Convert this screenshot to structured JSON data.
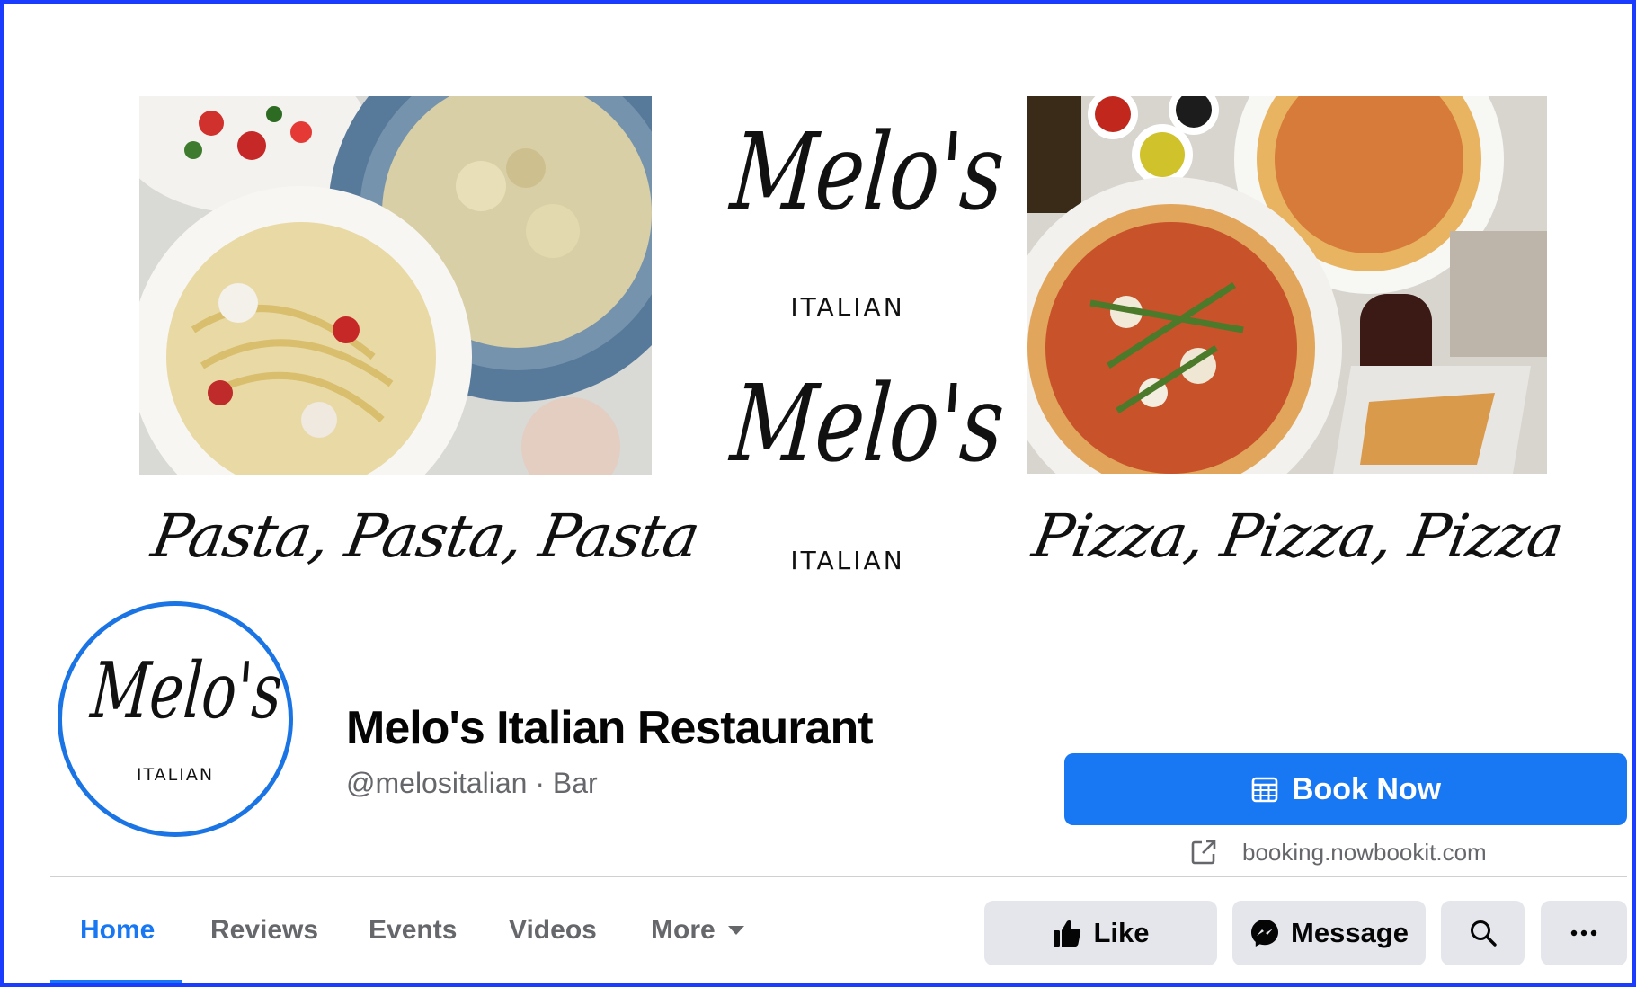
{
  "cover": {
    "logo_text": "Melo's",
    "logo_sub": "ITALIAN",
    "caption_left": "Pasta, Pasta, Pasta",
    "caption_right": "Pizza, Pizza, Pizza"
  },
  "profile": {
    "avatar_name": "Melo's",
    "avatar_sub": "ITALIAN",
    "page_name": "Melo's Italian Restaurant",
    "handle_category": "@melositalian · Bar"
  },
  "cta": {
    "book_label": "Book Now",
    "book_link": "booking.nowbookit.com"
  },
  "tabs": [
    {
      "label": "Home",
      "active": true
    },
    {
      "label": "Reviews"
    },
    {
      "label": "Events"
    },
    {
      "label": "Videos"
    },
    {
      "label": "More"
    }
  ],
  "actions": {
    "like_label": "Like",
    "message_label": "Message"
  },
  "colors": {
    "accent": "#1877f2",
    "frame": "#1a3cff",
    "button_gray": "#e4e6eb",
    "secondary_text": "#65676b"
  },
  "icons": [
    "calendar-icon",
    "external-link-icon",
    "thumbs-up-icon",
    "messenger-icon",
    "search-icon",
    "more-dots-icon",
    "caret-down-icon"
  ]
}
